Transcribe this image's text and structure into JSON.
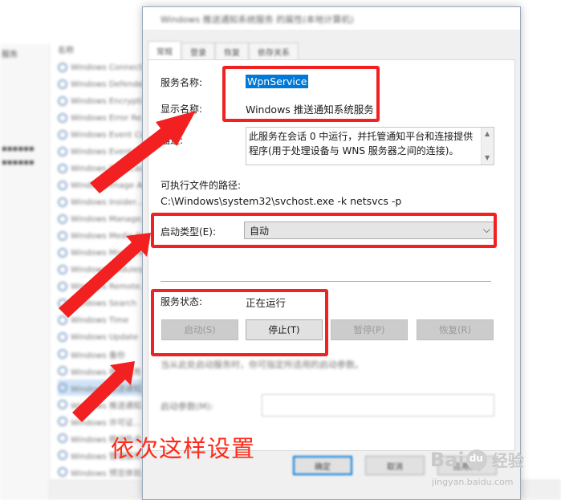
{
  "bg": {
    "left_items": [
      "服务",
      "",
      "",
      "",
      "",
      "",
      ""
    ],
    "list_header": "名称",
    "rows": [
      "Windows Connect...",
      "Windows Defende...",
      "Windows Encrypti...",
      "Windows Error Re...",
      "Windows Event Co...",
      "Windows Event Log",
      "Windows Font Cac...",
      "Windows Image Ac...",
      "Windows Insider...",
      "Windows Manage...",
      "Windows Media P...",
      "Windows Mixed Re...",
      "Windows Modules...",
      "Windows Remote...",
      "Windows Search",
      "Windows Time",
      "Windows Update",
      "Windows 备份",
      "Windows 感知服务",
      "Windows 推送通知...",
      "Windows 推送通知...",
      "Windows 许可证...",
      "Windows 移动热点...",
      "Windows 管理服务",
      "Windows 预览体验..."
    ]
  },
  "dialog": {
    "title": "Windows 推送通知系统服务 的属性(本地计算机)",
    "tabs": [
      "常规",
      "登录",
      "恢复",
      "依存关系"
    ],
    "service_name_label": "服务名称:",
    "service_name_value": "WpnService",
    "display_name_label": "显示名称:",
    "display_name_value": "Windows 推送通知系统服务",
    "description_label": "描述:",
    "description_value": "此服务在会话 0 中运行，并托管通知平台和连接提供程序(用于处理设备与 WNS 服务器之间的连接)。",
    "path_label": "可执行文件的路径:",
    "path_value": "C:\\Windows\\system32\\svchost.exe -k netsvcs -p",
    "startup_type_label": "启动类型(E):",
    "startup_type_value": "自动",
    "status_label": "服务状态:",
    "status_value": "正在运行",
    "buttons": {
      "start": "启动(S)",
      "stop": "停止(T)",
      "pause": "暂停(P)",
      "resume": "恢复(R)"
    },
    "hint_text": "当从此处启动服务时，你可指定所适用的启动参数。",
    "params_label": "启动参数(M):",
    "footer": {
      "ok": "确定",
      "cancel": "取消",
      "apply": "应用(A)"
    }
  },
  "annotation": {
    "text": "依次这样设置",
    "color": "#f22020"
  },
  "watermark": {
    "brand": "Bai",
    "brand2": "du",
    "cn": "经验",
    "url": "jingyan.baidu.com"
  },
  "colors": {
    "selection": "#0078d7",
    "annotation_red": "#f22020"
  }
}
